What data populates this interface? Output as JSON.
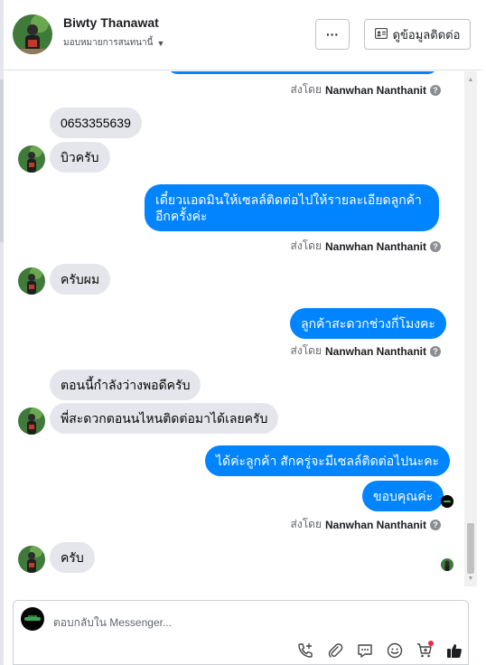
{
  "header": {
    "name": "Biwty Thanawat",
    "assign_label": "มอบหมายการสนทนานี้",
    "more_label": "···",
    "contact_label": "ดูข้อมูลติดต่อ"
  },
  "sent_by": {
    "prefix": "ส่งโดย",
    "agent": "Nanwhan Nanthanit"
  },
  "messages": [
    {
      "from": "customer",
      "text": "0653355639"
    },
    {
      "from": "customer",
      "text": "บิวครับ"
    },
    {
      "from": "page",
      "text": "เดี๋ยวแอดมินให้เซลล์ติดต่อไปให้รายละเอียดลูกค้า อีกครั้งค่ะ"
    },
    {
      "from": "customer",
      "text": "ครับผม"
    },
    {
      "from": "page",
      "text": "ลูกค้าสะดวกช่วงกี่โมงคะ"
    },
    {
      "from": "customer",
      "text": "ตอนนี้กำลังว่างพอดีครับ"
    },
    {
      "from": "customer",
      "text": "พี่สะดวกตอนนไหนติดต่อมาได้เลยครับ"
    },
    {
      "from": "page",
      "text": "ได้ค่ะลูกค้า สักครู่จะมีเซลล์ติดต่อไปนะคะ"
    },
    {
      "from": "page",
      "text": "ขอบคุณค่ะ"
    },
    {
      "from": "customer",
      "text": "ครับ"
    }
  ],
  "message_lines": {
    "m3_line1": "เดี๋ยวแอดมินให้เซลล์ติดต่อไปให้รายละเอียดลูกค้า",
    "m3_line2": "อีกครั้งค่ะ"
  },
  "composer": {
    "placeholder": "ตอบกลับใน Messenger..."
  },
  "colors": {
    "outgoing_bubble": "#0084ff",
    "incoming_bubble": "#e4e6eb",
    "like": "#050505"
  },
  "icons": [
    "more-icon",
    "contact-card-icon",
    "add-call-icon",
    "attach-icon",
    "saved-reply-icon",
    "emoji-icon",
    "cart-icon",
    "like-icon"
  ]
}
